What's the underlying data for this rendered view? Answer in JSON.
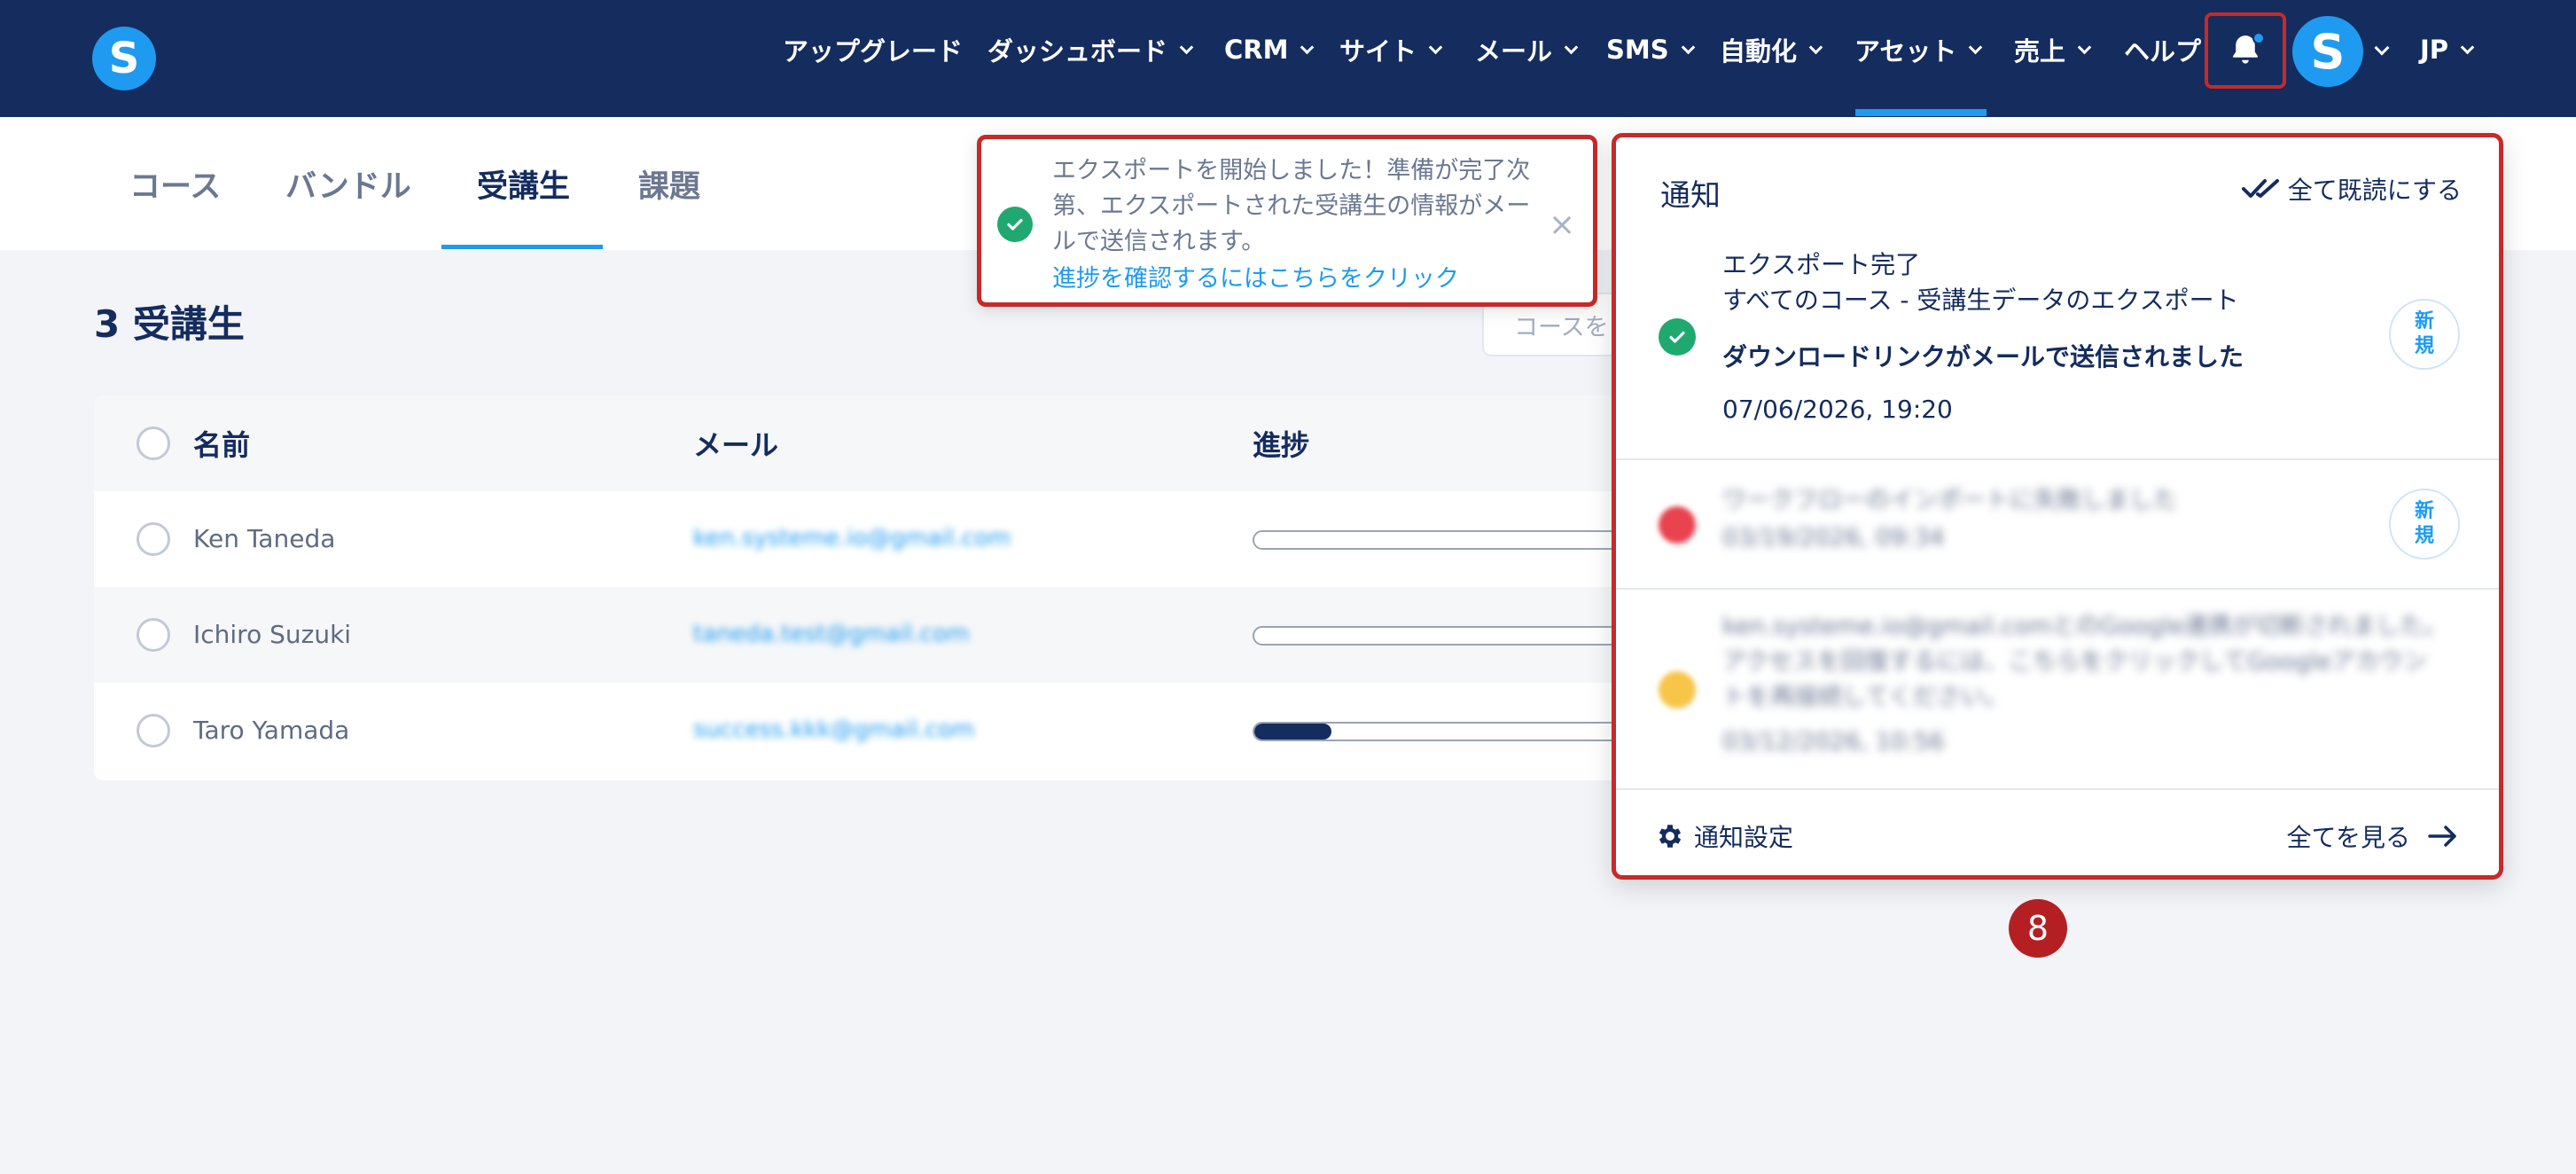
{
  "nav": {
    "logo": "S",
    "items": [
      {
        "label": "アップグレード",
        "chevron": false
      },
      {
        "label": "ダッシュボード",
        "chevron": true
      },
      {
        "label": "CRM",
        "chevron": true
      },
      {
        "label": "サイト",
        "chevron": true
      },
      {
        "label": "メール",
        "chevron": true
      },
      {
        "label": "SMS",
        "chevron": true
      },
      {
        "label": "自動化",
        "chevron": true
      },
      {
        "label": "アセット",
        "chevron": true
      },
      {
        "label": "売上",
        "chevron": true
      },
      {
        "label": "ヘルプ",
        "chevron": false
      }
    ],
    "avatar_letter": "S",
    "language": "JP",
    "bell_has_unread": true
  },
  "tabs": [
    {
      "label": "コース",
      "active": false
    },
    {
      "label": "バンドル",
      "active": false
    },
    {
      "label": "受講生",
      "active": true
    },
    {
      "label": "課題",
      "active": false
    }
  ],
  "page": {
    "title": "3 受講生",
    "search_placeholder": "コースを"
  },
  "table": {
    "headers": {
      "name": "名前",
      "email": "メール",
      "progress": "進捗"
    },
    "rows": [
      {
        "name": "Ken Taneda",
        "email": "ken.systeme.io@gmail.com",
        "progress": 0
      },
      {
        "name": "Ichiro Suzuki",
        "email": "taneda.test@gmail.com",
        "progress": 0
      },
      {
        "name": "Taro Yamada",
        "email": "success.kkk@gmail.com",
        "progress": 0.21
      }
    ]
  },
  "toast": {
    "message": "エクスポートを開始しました！準備が完了次第、エクスポートされた受講生の情報がメールで送信されます。",
    "link": "進捗を確認するにはこちらをクリック",
    "close": "×"
  },
  "notifications": {
    "title": "通知",
    "mark_all_read": "全て既読にする",
    "items": [
      {
        "title": "エクスポート完了",
        "subtitle": "すべてのコース - 受講生データのエクスポート",
        "message": "ダウンロードリンクがメールで送信されました",
        "timestamp": "07/06/2026, 19:20",
        "badge_line1": "新",
        "badge_line2": "規"
      },
      {
        "title": "ワークフローのインポートに失敗しました",
        "timestamp": "03/19/2026, 09:34",
        "badge_line1": "新",
        "badge_line2": "規"
      },
      {
        "message": "ken.systeme.io@gmail.comとのGoogle連携が切断されました。アクセスを回復するには、こちらをクリックしてGoogleアカウントを再接続してください。",
        "timestamp": "03/12/2026, 10:56"
      }
    ],
    "settings_label": "通知設定",
    "view_all_label": "全てを見る"
  },
  "step_marker": "8"
}
